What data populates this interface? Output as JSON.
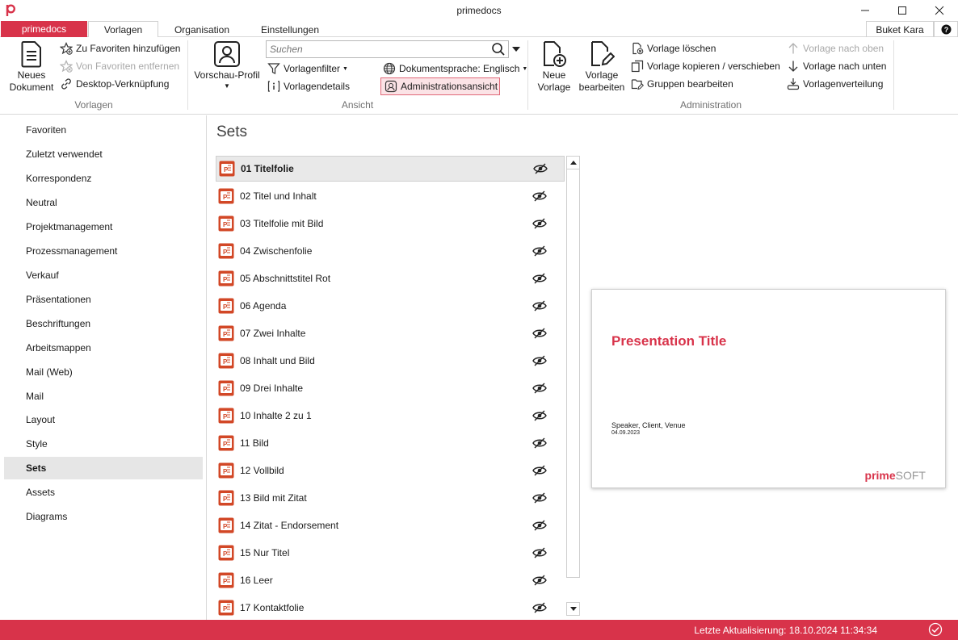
{
  "window": {
    "title": "primedocs",
    "minimize": "—",
    "maximize": "☐",
    "close": "✕"
  },
  "tabs": {
    "brand": "primedocs",
    "items": [
      "Vorlagen",
      "Organisation",
      "Einstellungen"
    ],
    "active": "Vorlagen",
    "user": "Buket Kara",
    "help": "?"
  },
  "ribbon": {
    "vorlagen_group": {
      "label": "Vorlagen",
      "new_document": [
        "Neues",
        "Dokument"
      ],
      "add_favorite": "Zu Favoriten hinzufügen",
      "remove_favorite": "Von Favoriten entfernen",
      "desktop_link": "Desktop-Verknüpfung"
    },
    "ansicht_group": {
      "label": "Ansicht",
      "preview_profile": "Vorschau-Profil",
      "search_placeholder": "Suchen",
      "template_filter": "Vorlagenfilter",
      "template_details": "Vorlagendetails",
      "doc_language": "Dokumentsprache: Englisch",
      "admin_view": "Administrationsansicht"
    },
    "admin_group": {
      "label": "Administration",
      "new_template": [
        "Neue",
        "Vorlage"
      ],
      "edit_template": [
        "Vorlage",
        "bearbeiten"
      ],
      "delete_template": "Vorlage löschen",
      "copy_move_template": "Vorlage kopieren / verschieben",
      "edit_groups": "Gruppen bearbeiten",
      "move_up": "Vorlage nach oben",
      "move_down": "Vorlage nach unten",
      "distribution": "Vorlagenverteilung"
    }
  },
  "sidebar": {
    "items": [
      "Favoriten",
      "Zuletzt verwendet",
      "Korrespondenz",
      "Neutral",
      "Projektmanagement",
      "Prozessmanagement",
      "Verkauf",
      "Präsentationen",
      "Beschriftungen",
      "Arbeitsmappen",
      "Mail (Web)",
      "Mail",
      "Layout",
      "Style",
      "Sets",
      "Assets",
      "Diagrams"
    ],
    "active": "Sets"
  },
  "main": {
    "title": "Sets",
    "templates": [
      "01 Titelfolie",
      "02 Titel und Inhalt",
      "03 Titelfolie mit Bild",
      "04 Zwischenfolie",
      "05 Abschnittstitel Rot",
      "06 Agenda",
      "07 Zwei Inhalte",
      "08 Inhalt und Bild",
      "09 Drei Inhalte",
      "10 Inhalte 2 zu 1",
      "11 Bild",
      "12 Vollbild",
      "13 Bild mit Zitat",
      "14 Zitat - Endorsement",
      "15 Nur Titel",
      "16 Leer",
      "17 Kontaktfolie"
    ],
    "selected": "01 Titelfolie"
  },
  "preview": {
    "title": "Presentation Title",
    "speaker": "Speaker, Client, Venue",
    "date": "04.09.2023",
    "logo_prime": "prime",
    "logo_soft": "SOFT"
  },
  "status": {
    "last_update": "Letzte Aktualisierung: 18.10.2024 11:34:34"
  },
  "colors": {
    "accent": "#d8334a",
    "admin_view_bg": "#fbe3e6"
  }
}
